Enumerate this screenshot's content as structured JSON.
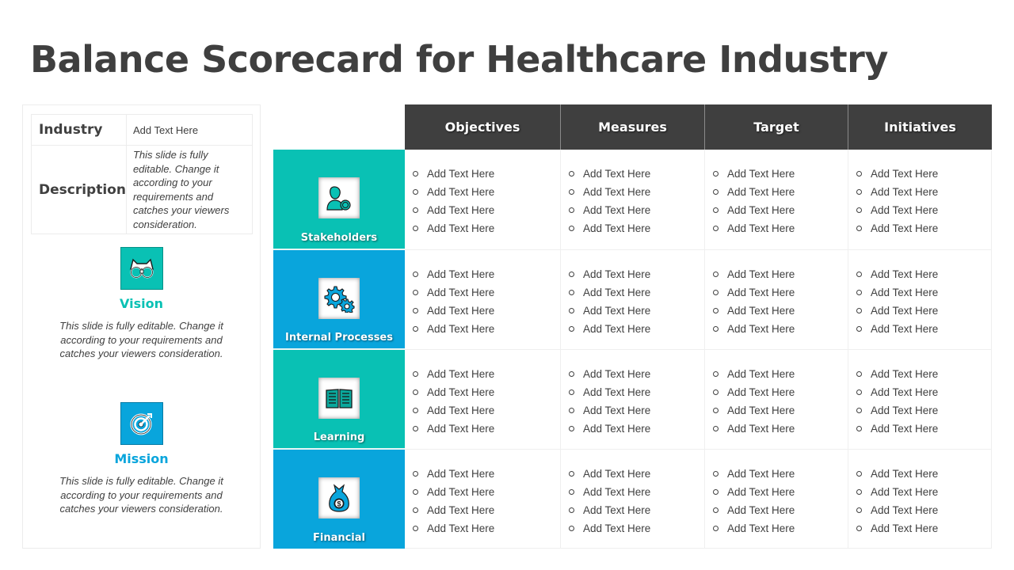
{
  "title": "Balance Scorecard for Healthcare Industry",
  "colors": {
    "teal": "#09c1b4",
    "blue": "#09a5dc",
    "header_dark": "#3f3f3f",
    "text": "#404040"
  },
  "info": {
    "industry_label": "Industry",
    "industry_value": "Add Text Here",
    "description_label": "Description",
    "description_value": "This slide is fully editable. Change it according to your requirements and catches your viewers consideration."
  },
  "vision": {
    "icon": "binoculars-icon",
    "title": "Vision",
    "text": "This slide is fully editable. Change it according to your requirements and catches your viewers consideration."
  },
  "mission": {
    "icon": "target-icon",
    "title": "Mission",
    "text": "This slide is fully editable. Change it according to your requirements and catches your viewers consideration."
  },
  "columns": [
    "Objectives",
    "Measures",
    "Target",
    "Initiatives"
  ],
  "rows": [
    {
      "label": "Stakeholders",
      "icon": "stakeholder-icon",
      "cells": [
        [
          "Add Text Here",
          "Add Text Here",
          "Add Text Here",
          "Add Text Here"
        ],
        [
          "Add Text Here",
          "Add Text Here",
          "Add Text Here",
          "Add Text Here"
        ],
        [
          "Add Text Here",
          "Add Text Here",
          "Add Text Here",
          "Add Text Here"
        ],
        [
          "Add Text Here",
          "Add Text Here",
          "Add Text Here",
          "Add Text Here"
        ]
      ]
    },
    {
      "label": "Internal Processes",
      "icon": "gears-icon",
      "cells": [
        [
          "Add Text Here",
          "Add Text Here",
          "Add Text Here",
          "Add Text Here"
        ],
        [
          "Add Text Here",
          "Add Text Here",
          "Add Text Here",
          "Add Text Here"
        ],
        [
          "Add Text Here",
          "Add Text Here",
          "Add Text Here",
          "Add Text Here"
        ],
        [
          "Add Text Here",
          "Add Text Here",
          "Add Text Here",
          "Add Text Here"
        ]
      ]
    },
    {
      "label": "Learning",
      "icon": "book-icon",
      "cells": [
        [
          "Add Text Here",
          "Add Text Here",
          "Add Text Here",
          "Add Text Here"
        ],
        [
          "Add Text Here",
          "Add Text Here",
          "Add Text Here",
          "Add Text Here"
        ],
        [
          "Add Text Here",
          "Add Text Here",
          "Add Text Here",
          "Add Text Here"
        ],
        [
          "Add Text Here",
          "Add Text Here",
          "Add Text Here",
          "Add Text Here"
        ]
      ]
    },
    {
      "label": "Financial",
      "icon": "money-bag-icon",
      "cells": [
        [
          "Add Text Here",
          "Add Text Here",
          "Add Text Here",
          "Add Text Here"
        ],
        [
          "Add Text Here",
          "Add Text Here",
          "Add Text Here",
          "Add Text Here"
        ],
        [
          "Add Text Here",
          "Add Text Here",
          "Add Text Here",
          "Add Text Here"
        ],
        [
          "Add Text Here",
          "Add Text Here",
          "Add Text Here",
          "Add Text Here"
        ]
      ]
    }
  ]
}
